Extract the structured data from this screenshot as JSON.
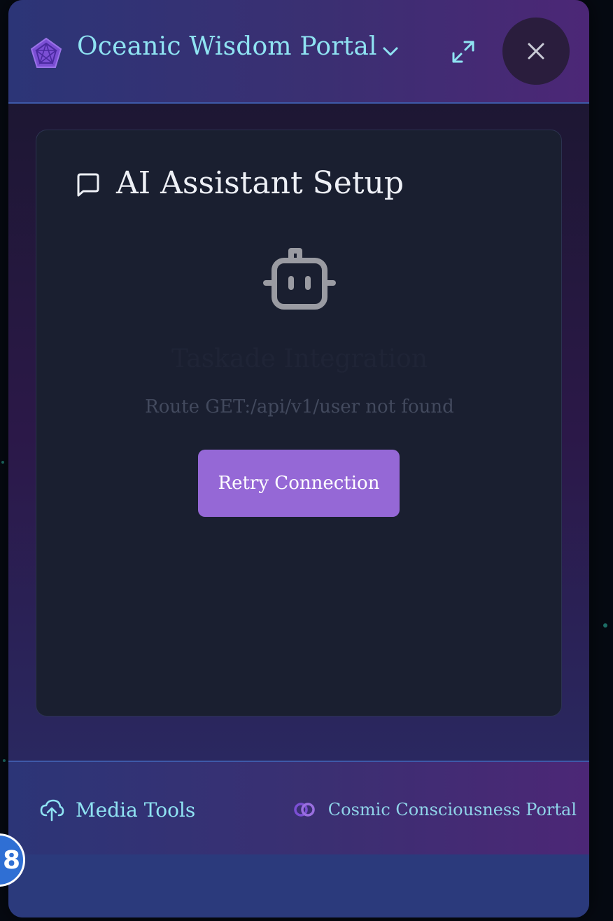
{
  "header": {
    "title": "Oceanic Wisdom Portal",
    "logo_icon": "pentagram-gem-icon",
    "buttons": [
      "chevron-down-icon",
      "expand-icon",
      "close-icon"
    ]
  },
  "card": {
    "title": "AI Assistant Setup",
    "title_icon": "message-square-icon",
    "bot_icon": "robot-icon",
    "integration_title": "Taskade Integration",
    "error_message": "Route GET:/api/v1/user not found",
    "retry_label": "Retry Connection"
  },
  "footer": {
    "media_tools_label": "Media Tools",
    "media_tools_icon": "cloud-upload-icon",
    "portal_label": "Cosmic Consciousness Portal",
    "portal_icon": "linked-circles-icon"
  },
  "floating_button": {
    "label": "8"
  },
  "colors": {
    "accent_cyan": "#8fe3f2",
    "accent_purple": "#9568d6",
    "card_bg": "#1a1f30"
  }
}
